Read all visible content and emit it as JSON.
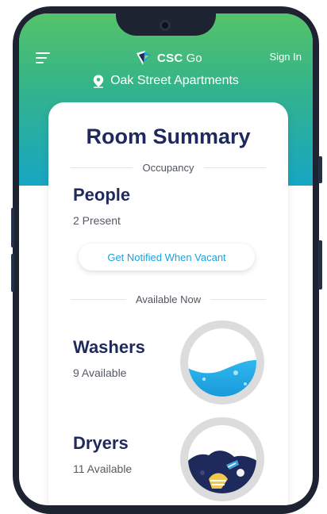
{
  "header": {
    "brand_strong": "CSC",
    "brand_light": "Go",
    "signin_label": "Sign In"
  },
  "location": {
    "name": "Oak Street Apartments"
  },
  "summary": {
    "title": "Room Summary",
    "occupancy_label": "Occupancy",
    "people_title": "People",
    "people_count": "2 Present",
    "notify_button": "Get Notified When Vacant",
    "available_label": "Available Now",
    "washers": {
      "title": "Washers",
      "status": "9 Available",
      "icon": "washer-water-icon"
    },
    "dryers": {
      "title": "Dryers",
      "status": "11 Available",
      "icon": "dryer-clothes-icon"
    }
  },
  "colors": {
    "navy": "#1f2a5c",
    "accent": "#1aa3dc",
    "green": "#55c36a",
    "teal": "#17a6c4"
  }
}
